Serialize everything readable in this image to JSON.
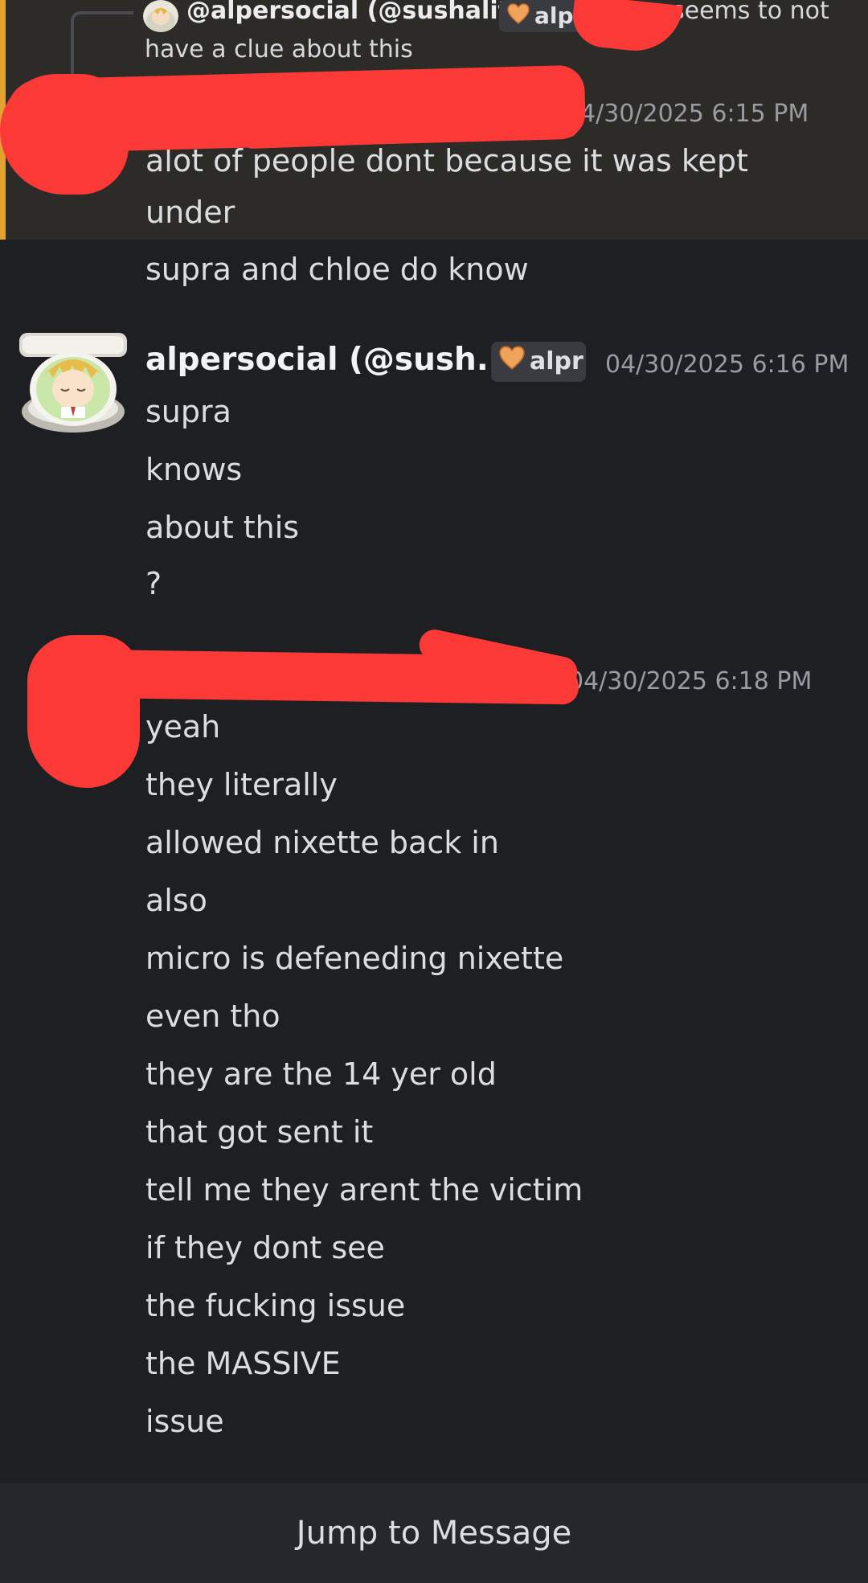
{
  "reply": {
    "author": "@alpersocial (@sushality)",
    "tag": "alpr",
    "text_end": "seems to not",
    "text_line2": "have a clue about this"
  },
  "message1": {
    "timestamp": "4/30/2025 6:15 PM",
    "lines": [
      "alot of people dont because it was kept",
      "under",
      "supra and chloe do know"
    ]
  },
  "message2": {
    "author": "alpersocial (@sush...",
    "tag": "alpr",
    "timestamp": "04/30/2025 6:16 PM",
    "lines": [
      "supra",
      "knows",
      "about this",
      "?"
    ]
  },
  "message3": {
    "timestamp": "04/30/2025 6:18 PM",
    "lines": [
      "yeah",
      "they literally",
      "allowed nixette back in",
      "also",
      "micro is defeneding nixette",
      "even tho",
      "they are the 14 yer old",
      "that got sent it",
      "tell me they arent the victim",
      "if they dont see",
      "the fucking issue",
      "the MASSIVE",
      "issue"
    ]
  },
  "footer": {
    "jump_label": "Jump to Message"
  },
  "colors": {
    "background": "#1e1f23",
    "highlight_bg": "#2d2b27",
    "highlight_bar": "#e3a330",
    "redaction": "#fb3a37",
    "footer_bg": "#26272d"
  }
}
